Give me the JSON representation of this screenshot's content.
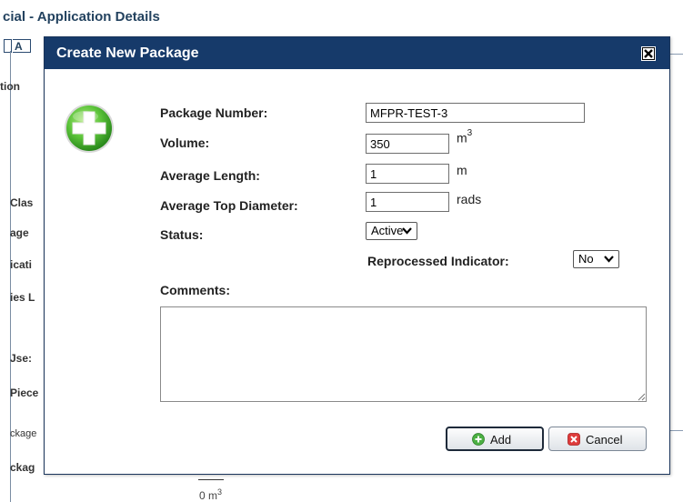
{
  "background": {
    "title": "cial - Application Details",
    "tabs": [
      "",
      "A"
    ],
    "labels": [
      "tion",
      "Clas",
      "age",
      "icati",
      "ies L",
      "Jse:",
      "Piece",
      "ckage",
      "ckag"
    ],
    "bottom_value": "0",
    "bottom_unit": "m",
    "bottom_unit_sup": "3"
  },
  "dialog": {
    "title": "Create New Package",
    "close_icon": "close-icon",
    "add_icon": "green-plus-icon",
    "fields": {
      "package_number": {
        "label": "Package Number:",
        "value": "MFPR-TEST-3"
      },
      "volume": {
        "label": "Volume:",
        "value": "350",
        "unit": "m",
        "unit_sup": "3"
      },
      "average_length": {
        "label": "Average Length:",
        "value": "1",
        "unit": "m"
      },
      "average_top_diameter": {
        "label": "Average Top Diameter:",
        "value": "1",
        "unit": "rads"
      },
      "status": {
        "label": "Status:",
        "selected": "Active"
      },
      "reprocessed_indicator": {
        "label": "Reprocessed Indicator:",
        "selected": "No"
      },
      "comments": {
        "label": "Comments:",
        "value": ""
      }
    },
    "buttons": {
      "add": "Add",
      "cancel": "Cancel"
    }
  },
  "colors": {
    "titlebar": "#163a6a",
    "title_text": "#ffffff",
    "accent_green": "#3aa53a",
    "cancel_red": "#d93b3b"
  }
}
